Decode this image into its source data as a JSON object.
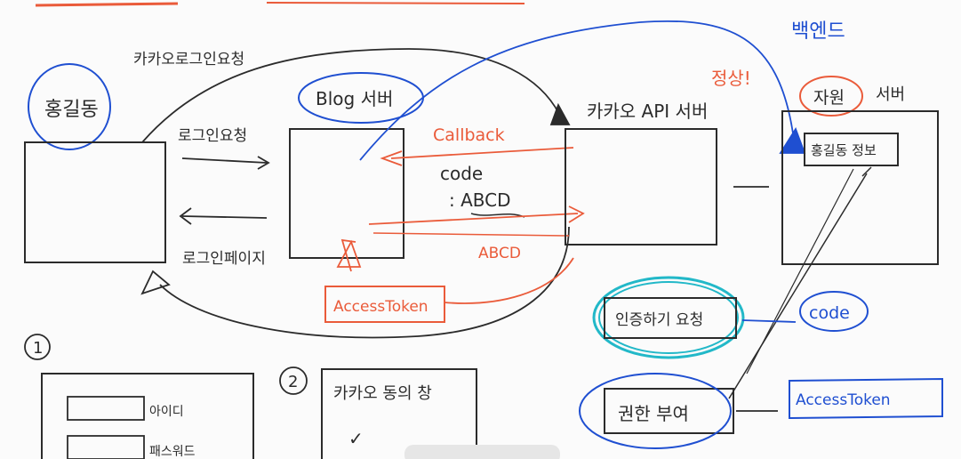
{
  "top_note": "카카오로그인요청",
  "user": {
    "name": "홍길동"
  },
  "blog_server": {
    "title": "Blog 서버"
  },
  "kakao_api": {
    "title": "카카오 API 서버"
  },
  "resource_server": {
    "title_circled": "자원",
    "title_rest": "서버",
    "user_info": "홍길동 정보"
  },
  "backend_label": "백엔드",
  "ok_label": "정상!",
  "arrows": {
    "login_request": "로그인요청",
    "login_page": "로그인페이지",
    "callback": "Callback",
    "code_label": "code",
    "code_value": ": ABCD",
    "abcd": "ABCD"
  },
  "access_token_box": "AccessToken",
  "steps": {
    "step1_marker": "1",
    "step1_fields": [
      "아이디",
      "패스워드"
    ],
    "step2_marker": "2",
    "step2_title": "카카오 동의 창",
    "step2_check": "✓"
  },
  "legend": {
    "auth_code_box": "인증하기 요청",
    "auth_code_label": "code",
    "grant_box": "권한 부여",
    "grant_label": "AccessToken"
  },
  "colors": {
    "ink": "#2b2b2b",
    "blue": "#1f4fd1",
    "red": "#ea5b3a",
    "cyan": "#22b8c8"
  }
}
